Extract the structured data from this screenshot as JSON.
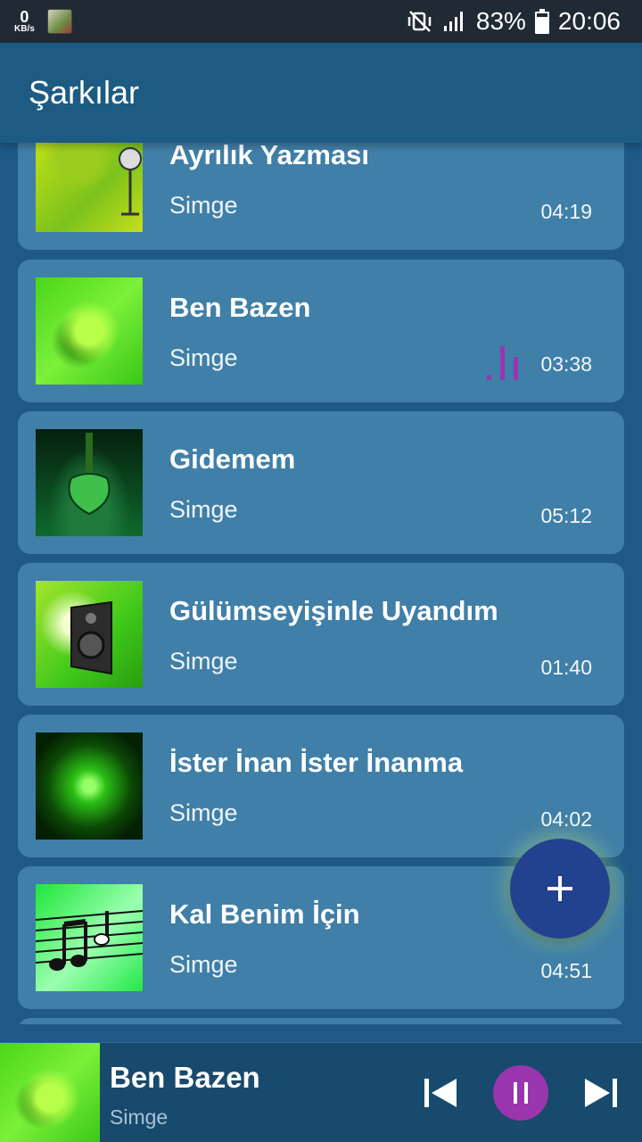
{
  "status_bar": {
    "speed_value": "0",
    "speed_unit": "KB/s",
    "battery": "83%",
    "time": "20:06",
    "icons": [
      "app-notification-icon",
      "mute-vibrate-icon",
      "signal-icon",
      "battery-icon"
    ]
  },
  "app_bar": {
    "title": "Şarkılar"
  },
  "songs": [
    {
      "title": "Ayrılık Yazması",
      "artist": "Simge",
      "duration": "04:19",
      "playing": false
    },
    {
      "title": "Ben Bazen",
      "artist": "Simge",
      "duration": "03:38",
      "playing": true
    },
    {
      "title": "Gidemem",
      "artist": "Simge",
      "duration": "05:12",
      "playing": false
    },
    {
      "title": "Gülümseyişinle Uyandım",
      "artist": "Simge",
      "duration": "01:40",
      "playing": false
    },
    {
      "title": "İster İnan İster İnanma",
      "artist": "Simge",
      "duration": "04:02",
      "playing": false
    },
    {
      "title": "Kal Benim İçin",
      "artist": "Simge",
      "duration": "04:51",
      "playing": false
    }
  ],
  "fab": {
    "icon": "plus-icon"
  },
  "now_playing": {
    "title": "Ben Bazen",
    "artist": "Simge",
    "controls": [
      "previous-icon",
      "pause-icon",
      "next-icon"
    ]
  },
  "colors": {
    "background": "#1e5a85",
    "card": "#407fa7",
    "accent": "#9b35ad",
    "fab": "#22418f",
    "status_bar": "#1f2a35"
  }
}
